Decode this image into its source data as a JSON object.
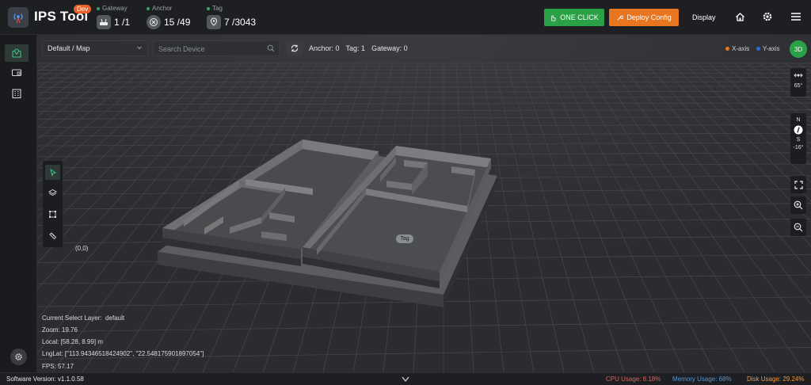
{
  "header": {
    "app_title": "IPS Tool",
    "dev_badge": "Dev",
    "stats": [
      {
        "label": "Gateway",
        "value": "1 /1",
        "icon": "router-icon"
      },
      {
        "label": "Anchor",
        "value": "15 /49",
        "icon": "anchor-icon"
      },
      {
        "label": "Tag",
        "value": "7 /3043",
        "icon": "tag-pin-icon"
      }
    ],
    "one_click_label": "ONE CLICK",
    "deploy_label": "Deploy Config",
    "display_label": "Display"
  },
  "toolbar": {
    "map_select": "Default / Map",
    "search_placeholder": "Search Device",
    "anchor_count": "Anchor: 0",
    "tag_count": "Tag: 1",
    "gateway_count": "Gateway: 0",
    "x_axis_label": "X-axis",
    "y_axis_label": "Y-axis",
    "view_mode": "3D"
  },
  "controls": {
    "tilt_value": "65°",
    "compass_n": "N",
    "compass_s": "S",
    "heading_value": "-16°"
  },
  "scene": {
    "origin_label": "(0,0)",
    "tag_label": "Tag"
  },
  "info": {
    "layer_label": "Current Select Layer:",
    "layer_value": "default",
    "zoom": "Zoom:  19.76",
    "local": "Local:  [58.28,  8.99] m",
    "lnglat": "LngLat:  [\"113.94346518424902\", \"22.548175901897054\"]",
    "fps": "FPS:  57.17"
  },
  "status": {
    "version": "Software Version:  v1.1.0.58",
    "cpu": "CPU Usage:  8.18%",
    "memory": "Memory Usage:  68%",
    "disk": "Disk Usage:  29.24%"
  },
  "colors": {
    "accent_green": "#2aa147",
    "accent_orange": "#e8751f",
    "x_axis": "#e8751f",
    "y_axis": "#2f6bd6",
    "cpu": "#e0605a",
    "memory": "#4e9ad8",
    "disk": "#f09a3a"
  }
}
